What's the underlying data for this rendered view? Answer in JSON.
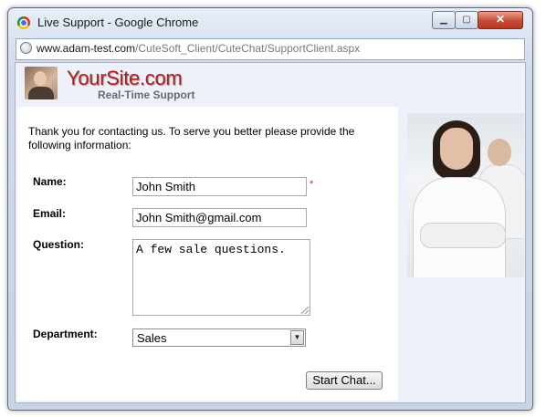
{
  "window": {
    "title": "Live Support - Google Chrome",
    "controls": {
      "minimize": "▁",
      "maximize": "▢",
      "close": "✕"
    }
  },
  "address": {
    "host": "www.adam-test.com",
    "path": "/CuteSoft_Client/CuteChat/SupportClient.aspx"
  },
  "header": {
    "site_name": "YourSite.com",
    "tagline": "Real-Time Support"
  },
  "form": {
    "intro": "Thank you for contacting us. To serve you better please provide the following information:",
    "name_label": "Name:",
    "name_value": "John Smith",
    "required_mark": "*",
    "email_label": "Email:",
    "email_value": "John Smith@gmail.com",
    "question_label": "Question:",
    "question_value": "A few sale questions.",
    "department_label": "Department:",
    "department_value": "Sales",
    "start_button": "Start Chat..."
  },
  "icons": [
    "chrome-logo-icon",
    "globe-icon",
    "chevron-down-icon"
  ]
}
